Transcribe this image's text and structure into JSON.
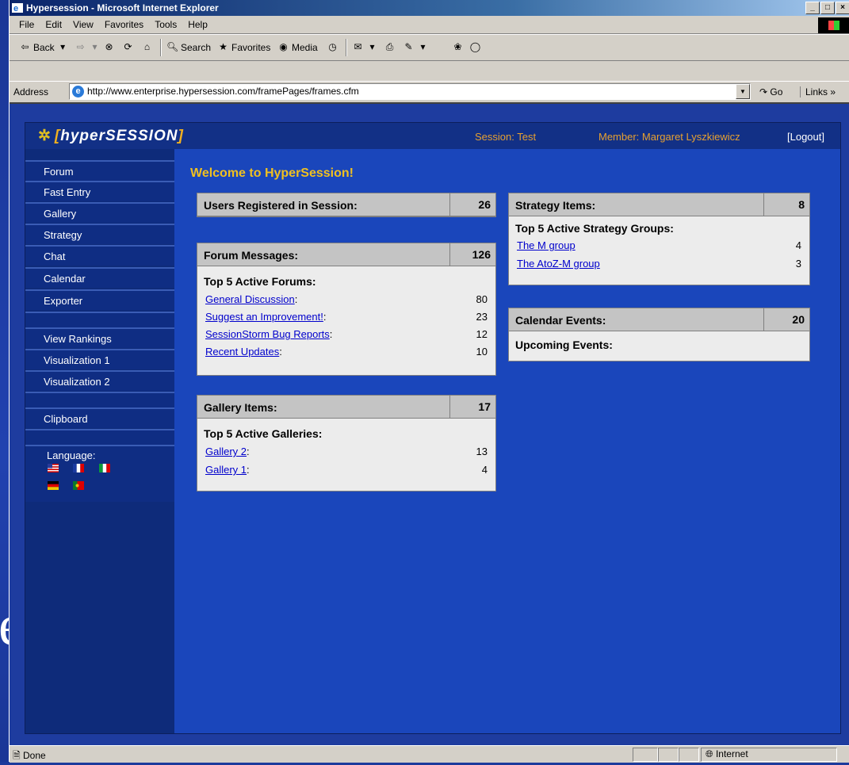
{
  "window": {
    "title": "Hypersession - Microsoft Internet Explorer"
  },
  "menu": [
    "File",
    "Edit",
    "View",
    "Favorites",
    "Tools",
    "Help"
  ],
  "toolbar": {
    "back": "Back",
    "search": "Search",
    "favorites": "Favorites",
    "media": "Media"
  },
  "address": {
    "label": "Address",
    "url": "http://www.enterprise.hypersession.com/framePages/frames.cfm",
    "go": "Go",
    "links": "Links"
  },
  "header": {
    "logo_open": "[",
    "logo_text": "hyperSESSION",
    "logo_close": "]",
    "session": "Session: Test",
    "member": "Member: Margaret Lyszkiewicz",
    "logout": "[Logout]"
  },
  "sidebar": {
    "items": [
      "Forum",
      "Fast Entry",
      "Gallery",
      "Strategy",
      "Chat",
      "Calendar",
      "Exporter"
    ],
    "items2": [
      "View Rankings",
      "Visualization 1",
      "Visualization 2"
    ],
    "items3": [
      "Clipboard"
    ],
    "language_label": "Language:"
  },
  "main": {
    "title": "Welcome to HyperSession!",
    "users": {
      "label": "Users Registered in Session:",
      "count": "26"
    },
    "forum": {
      "label": "Forum Messages:",
      "count": "126",
      "sub": "Top 5 Active Forums:",
      "rows": [
        {
          "name": "General Discussion",
          "count": "80"
        },
        {
          "name": "Suggest an Improvement!",
          "count": "23"
        },
        {
          "name": "SessionStorm Bug Reports",
          "count": "12"
        },
        {
          "name": "Recent Updates",
          "count": "10"
        }
      ]
    },
    "gallery": {
      "label": "Gallery Items:",
      "count": "17",
      "sub": "Top 5 Active Galleries:",
      "rows": [
        {
          "name": "Gallery 2",
          "count": "13"
        },
        {
          "name": "Gallery 1",
          "count": "4"
        }
      ]
    },
    "strategy": {
      "label": "Strategy Items:",
      "count": "8",
      "sub": "Top 5 Active Strategy Groups:",
      "rows": [
        {
          "name": "The M group",
          "count": "4"
        },
        {
          "name": "The AtoZ-M group",
          "count": "3"
        }
      ]
    },
    "calendar": {
      "label": "Calendar Events:",
      "count": "20",
      "sub": "Upcoming Events:"
    }
  },
  "status": {
    "text": "Done",
    "zone": "Internet"
  },
  "colors": {
    "page_bg": "#1a46bb",
    "header_accent": "#e6a030",
    "title": "#f0c020"
  }
}
